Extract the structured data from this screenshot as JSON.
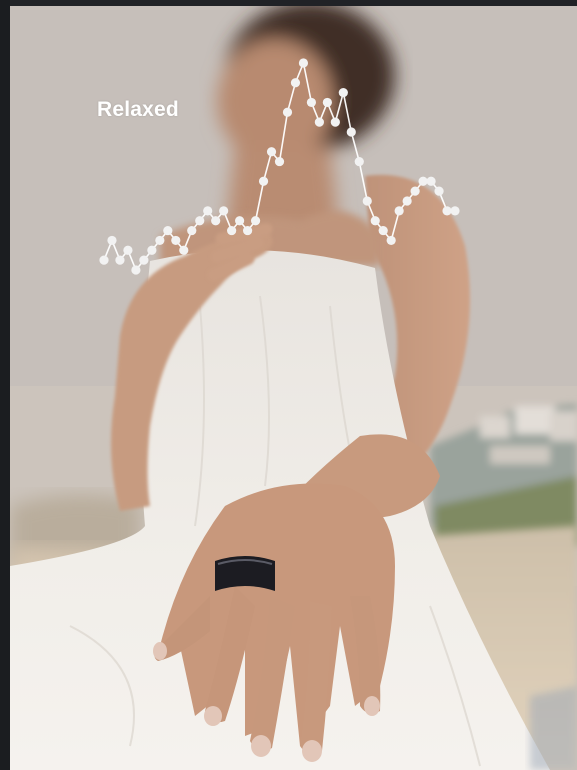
{
  "overlay": {
    "label": "Relaxed"
  },
  "photo": {
    "subject": "woman-wearing-smart-ring",
    "palette": {
      "sky": "#c7c0bb",
      "dress": "#efece7",
      "skin": "#c89a80",
      "hair": "#3b2a23",
      "sand": "#d9c8b0",
      "ring": "#1c1c22",
      "overlay_line": "#ffffff"
    }
  },
  "chart_data": {
    "type": "line",
    "title": "",
    "xlabel": "",
    "ylabel": "",
    "values": [
      4,
      6,
      4,
      5,
      3,
      4,
      5,
      6,
      7,
      6,
      5,
      7,
      8,
      9,
      8,
      9,
      7,
      8,
      7,
      8,
      12,
      15,
      14,
      19,
      22,
      24,
      20,
      18,
      20,
      18,
      21,
      17,
      14,
      10,
      8,
      7,
      6,
      9,
      10,
      11,
      12,
      12,
      11,
      9,
      9
    ]
  }
}
